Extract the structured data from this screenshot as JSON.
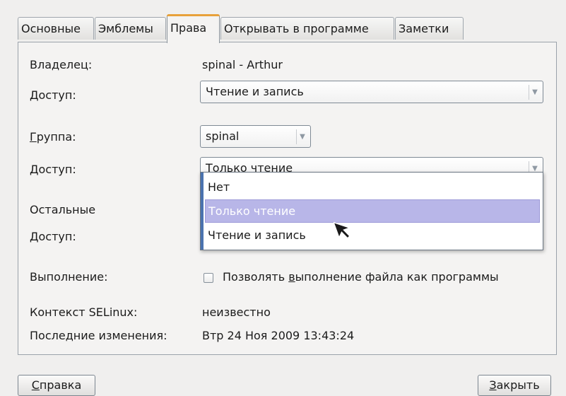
{
  "tabs": {
    "basic": "Основные",
    "emblems": "Эмблемы",
    "permissions": "Права",
    "open_with": "Открывать в программе",
    "notes": "Заметки"
  },
  "owner": {
    "label": "Владелец:",
    "value": "spinal - Arthur"
  },
  "owner_access": {
    "label": "Доступ:",
    "value": "Чтение и запись"
  },
  "group": {
    "label_first": "Г",
    "label_rest": "руппа:",
    "value": "spinal"
  },
  "group_access": {
    "label": "Доступ:",
    "value": "Только чтение"
  },
  "others": {
    "label": "Остальные"
  },
  "others_access": {
    "label": "Доступ:"
  },
  "dropdown": {
    "options": [
      "Нет",
      "Только чтение",
      "Чтение и запись"
    ],
    "selected": "Только чтение"
  },
  "execute": {
    "label": "Выполнение:",
    "checkbox_pre": "Позволять ",
    "checkbox_mnemonic": "в",
    "checkbox_post": "ыполнение файла как программы",
    "checked": false
  },
  "selinux": {
    "label": "Контекст SELinux:",
    "value": "неизвестно"
  },
  "modified": {
    "label": "Последние изменения:",
    "value": "Втр 24 Ноя 2009 13:43:24"
  },
  "buttons": {
    "help_mnemonic": "С",
    "help_rest": "правка",
    "close_mnemonic": "З",
    "close_rest": "акрыть"
  },
  "colors": {
    "active_tab_accent": "#e8a13a",
    "selection": "#b8b6e8",
    "list_stripe": "#4a72ae"
  },
  "icons": {
    "combo_arrow": "chevron-down-icon",
    "pointer": "mouse-pointer-icon"
  }
}
